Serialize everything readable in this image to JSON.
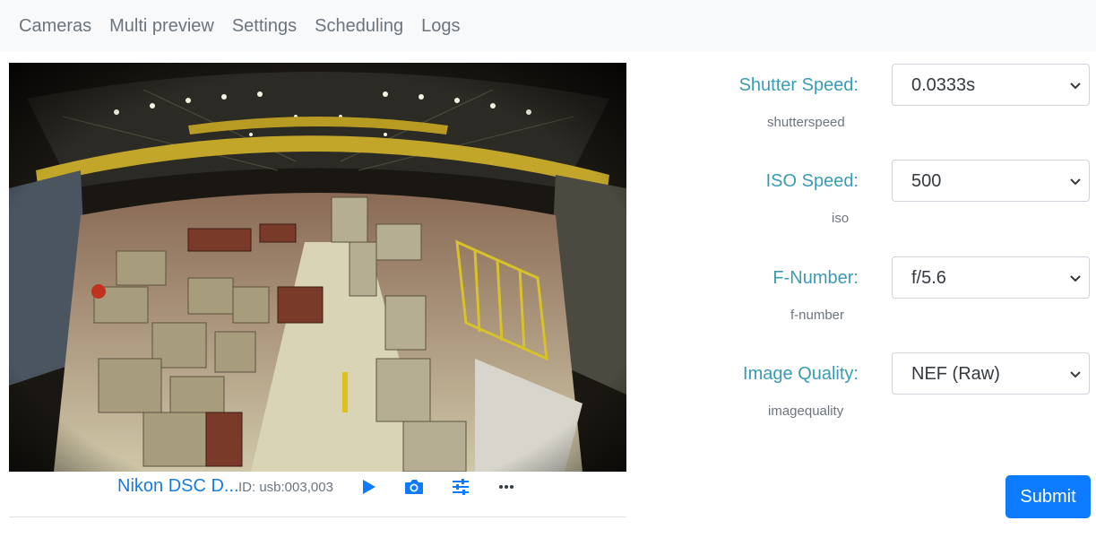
{
  "nav": {
    "items": [
      {
        "label": "Cameras"
      },
      {
        "label": "Multi preview"
      },
      {
        "label": "Settings"
      },
      {
        "label": "Scheduling"
      },
      {
        "label": "Logs"
      }
    ]
  },
  "camera": {
    "name": "Nikon DSC D...",
    "id_text": "ID: usb:003,003",
    "preview_description_icons": [
      "play-icon",
      "camera-icon",
      "sliders-icon",
      "more-icon"
    ]
  },
  "settings": {
    "fields": [
      {
        "label": "Shutter Speed:",
        "key": "shutterspeed",
        "value": "0.0333s"
      },
      {
        "label": "ISO Speed:",
        "key": "iso",
        "value": "500"
      },
      {
        "label": "F-Number:",
        "key": "f-number",
        "value": "f/5.6"
      },
      {
        "label": "Image Quality:",
        "key": "imagequality",
        "value": "NEF (Raw)"
      }
    ],
    "submit_label": "Submit"
  },
  "colors": {
    "navbar_bg": "#f8f9fa",
    "link": "#1a7be0",
    "label": "#3a9bb4",
    "primary": "#0d7bff"
  }
}
